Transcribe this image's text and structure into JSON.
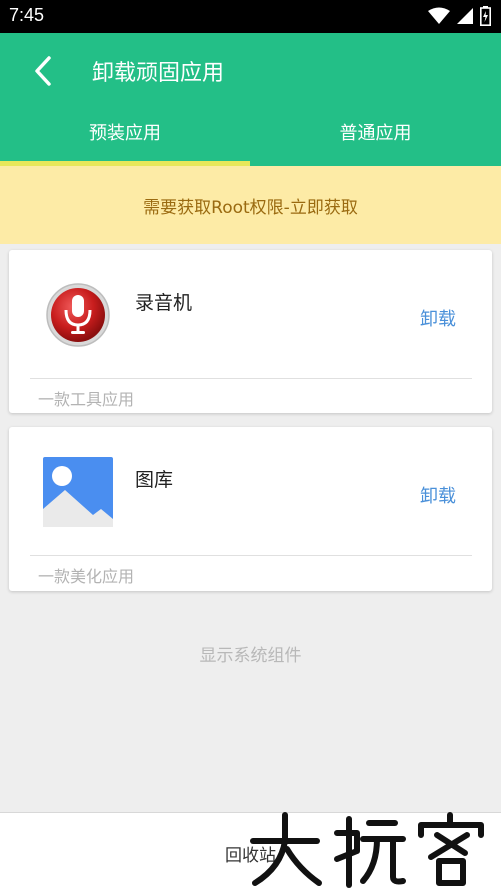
{
  "status_bar": {
    "time": "7:45"
  },
  "header": {
    "title": "卸载顽固应用"
  },
  "tabs": [
    {
      "label": "预装应用",
      "active": true
    },
    {
      "label": "普通应用",
      "active": false
    }
  ],
  "root_banner": {
    "text": "需要获取Root权限-立即获取"
  },
  "apps": [
    {
      "name": "录音机",
      "description": "一款工具应用",
      "action": "卸载",
      "icon": "microphone-icon"
    },
    {
      "name": "图库",
      "description": "一款美化应用",
      "action": "卸载",
      "icon": "gallery-icon"
    }
  ],
  "show_system_components": "显示系统组件",
  "bottom": {
    "recycle_bin": "回收站"
  },
  "colors": {
    "primary": "#23bf87",
    "tab_indicator": "#e8e75a",
    "banner_bg": "#fdeba6",
    "banner_text": "#9a6a10",
    "link": "#4a90d9"
  }
}
